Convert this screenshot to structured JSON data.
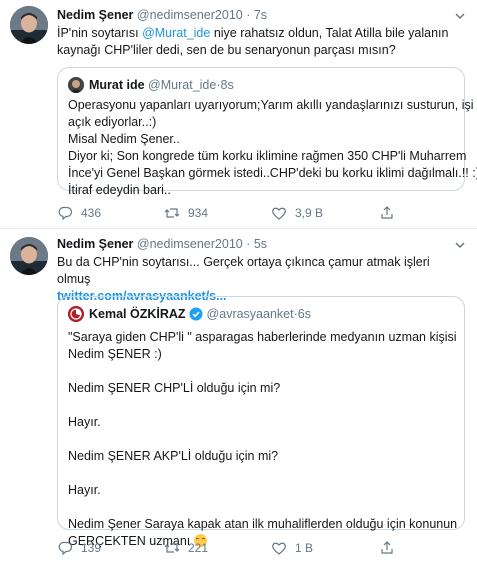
{
  "tweet1": {
    "name": "Nedim Şener",
    "handle": "@nedimsener2010",
    "sep": " · ",
    "time": "7s",
    "text_pre": "İP'nin soytarısı ",
    "mention": "@Murat_ide",
    "text_mid": " niye rahatsız oldun, Talat Atilla bile yalanın",
    "text_line2": "kaynağı CHP'liler dedi, sen de bu senaryonun parçası mısın?",
    "quote": {
      "name": "Murat ide",
      "handle": "@Murat_ide",
      "time": "8s",
      "lines": [
        "Operasyonu yapanları uyarıyorum;Yarım akıllı yandaşlarınızı susturun, işi",
        "açık ediyorlar..:)",
        "Misal Nedim Şener..",
        "Diyor ki; Son kongrede tüm korku iklimine rağmen 350 CHP'li Muharrem",
        "İnce'yi Genel Başkan görmek istedi..CHP'deki bu korku iklimi dağılmalı.!! :)",
        "İtiraf edeydin bari.."
      ]
    },
    "actions": {
      "replies": "436",
      "retweets": "934",
      "likes": "3,9 B"
    }
  },
  "tweet2": {
    "name": "Nedim Şener",
    "handle": "@nedimsener2010",
    "sep": " · ",
    "time": "5s",
    "text_line1": "Bu da CHP'nin soytarısı... Gerçek ortaya çıkınca çamur atmak işleri olmuş",
    "link": "twitter.com/avrasyaanket/s...",
    "quote": {
      "name": "Kemal ÖZKİRAZ",
      "handle": "@avrasyaanket",
      "time": "6s",
      "lines": [
        "\"Saraya giden CHP'li \" asparagas haberlerinde medyanın uzman kişisi",
        "Nedim ŞENER :)",
        "",
        "Nedim ŞENER CHP'Lİ olduğu için mi?",
        "",
        "Hayır.",
        "",
        "Nedim ŞENER AKP'Lİ olduğu için mi?",
        "",
        "Hayır.",
        "",
        "Nedim Şener Saraya kapak atan ilk muhaliflerden olduğu için konunun",
        "GERÇEKTEN uzmanı"
      ]
    },
    "actions": {
      "replies": "139",
      "retweets": "221",
      "likes": "1 B"
    }
  },
  "colors": {
    "link": "#1b95e0",
    "muted": "#657786",
    "border": "#ccd6dd",
    "verified": "#1da1f2"
  },
  "icons": [
    "chevron-down-icon",
    "reply-icon",
    "retweet-icon",
    "like-icon",
    "share-icon",
    "verified-icon",
    "laughing-emoji"
  ]
}
